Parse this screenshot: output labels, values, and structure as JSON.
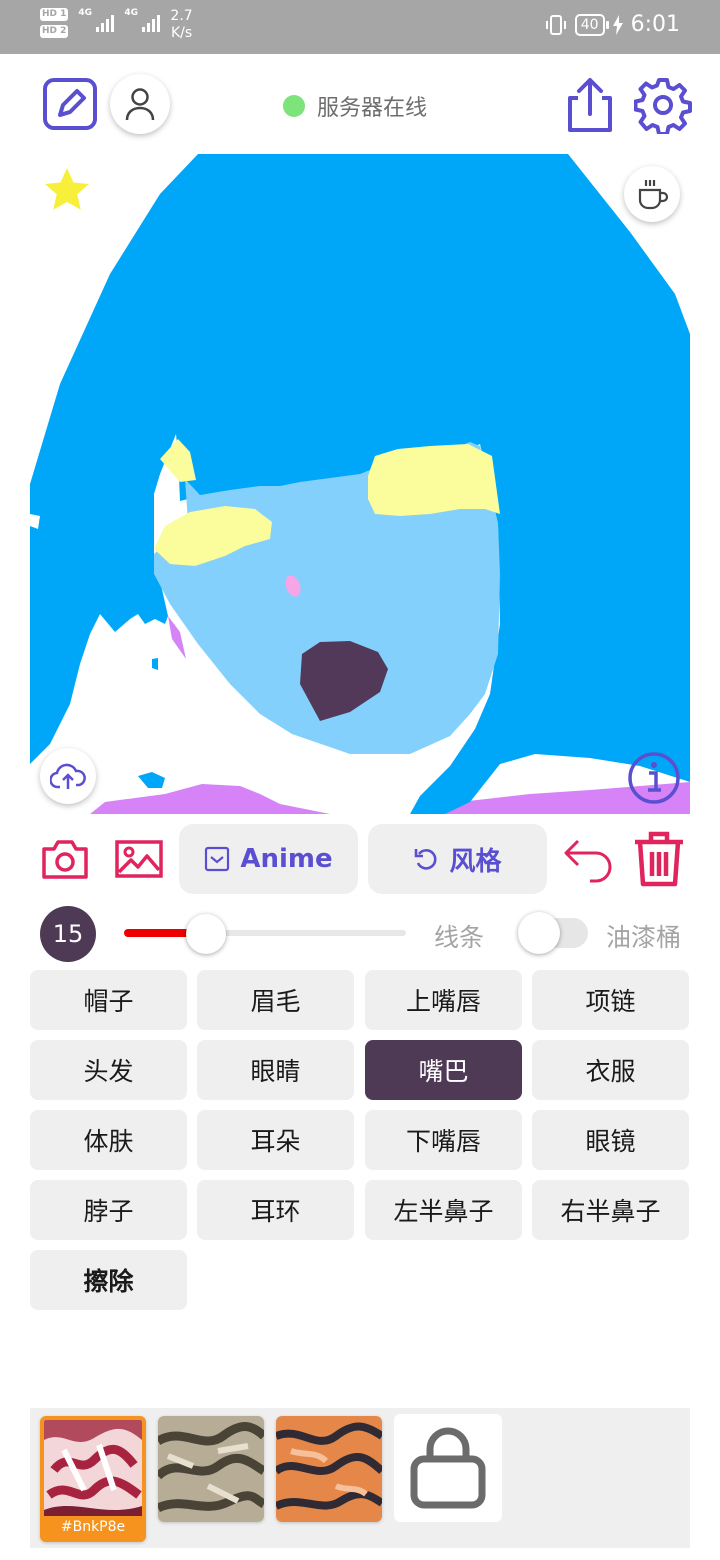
{
  "status_bar": {
    "sim1": "HD 1",
    "sim2": "HD 2",
    "net1": "4G",
    "net2": "4G",
    "speed_value": "2.7",
    "speed_unit": "K/s",
    "battery": "40",
    "time": "6:01"
  },
  "top_bar": {
    "server_status": "服务器在线",
    "status_color": "#7de37b"
  },
  "tools": {
    "anime_label": "Anime",
    "style_label": "风格"
  },
  "brush": {
    "size": "15",
    "size_fraction": 0.29,
    "line_label": "线条",
    "bucket_label": "油漆桶",
    "bucket_enabled": false
  },
  "categories": [
    {
      "label": "帽子",
      "selected": false
    },
    {
      "label": "眉毛",
      "selected": false
    },
    {
      "label": "上嘴唇",
      "selected": false
    },
    {
      "label": "项链",
      "selected": false
    },
    {
      "label": "头发",
      "selected": false
    },
    {
      "label": "眼睛",
      "selected": false
    },
    {
      "label": "嘴巴",
      "selected": true
    },
    {
      "label": "衣服",
      "selected": false
    },
    {
      "label": "体肤",
      "selected": false
    },
    {
      "label": "耳朵",
      "selected": false
    },
    {
      "label": "下嘴唇",
      "selected": false
    },
    {
      "label": "眼镜",
      "selected": false
    },
    {
      "label": "脖子",
      "selected": false
    },
    {
      "label": "耳环",
      "selected": false
    },
    {
      "label": "左半鼻子",
      "selected": false
    },
    {
      "label": "右半鼻子",
      "selected": false
    },
    {
      "label": "擦除",
      "selected": false
    }
  ],
  "styles": {
    "active_tag": "#BnkP8e"
  },
  "colors": {
    "accent": "#5b4fd1",
    "danger": "#e0245e",
    "selected": "#4f3a56",
    "hair": "#00a6f7",
    "skin": "#82d0fb",
    "eye": "#fbfc9b",
    "mouth": "#52395a",
    "clothes": "#d583f7"
  }
}
